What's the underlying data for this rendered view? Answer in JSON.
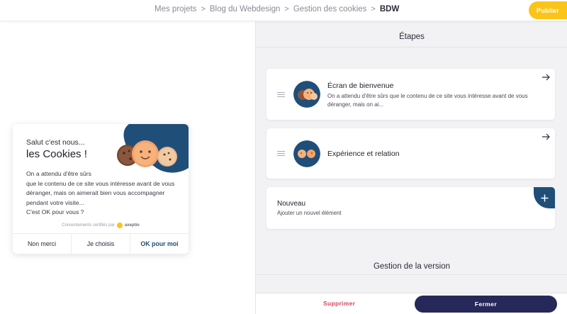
{
  "breadcrumb": {
    "items": [
      "Mes projets",
      "Blog du Webdesign",
      "Gestion des cookies"
    ],
    "separator": ">",
    "current": "BDW"
  },
  "header": {
    "publish_label": "Publier"
  },
  "preview": {
    "greeting": "Salut c'est nous...",
    "title": "les Cookies !",
    "body_lines": [
      "On a attendu d'être sûrs",
      "que le contenu de ce site vous intéresse avant de vous",
      "déranger, mais on aimerait bien vous accompagner",
      "pendant votre visite...",
      "C'est OK pour vous ?"
    ],
    "certified_label": "Consentements certifiés par",
    "certified_brand": "axeptio",
    "buttons": {
      "reject": "Non merci",
      "choose": "Je choisis",
      "accept": "OK pour moi"
    }
  },
  "panel": {
    "steps_heading": "Étapes",
    "steps": [
      {
        "title": "Écran de bienvenue",
        "description": "On a attendu d'être sûrs que le contenu de ce site vous intéresse avant de vous déranger, mais on ai..."
      },
      {
        "title": "Expérience et relation"
      }
    ],
    "new_item": {
      "title": "Nouveau",
      "description": "Ajouter un nouvel élément"
    },
    "version_heading": "Gestion de la version"
  },
  "footer": {
    "delete_label": "Supprimer",
    "close_label": "Fermer"
  },
  "icons": {
    "drag": "drag-handle-icon",
    "arrow": "arrow-right-icon",
    "add": "plus-icon"
  },
  "colors": {
    "publish": "#fbc418",
    "primary_dark": "#27285a",
    "accent_blue": "#1f4e79",
    "danger": "#d3455b"
  }
}
